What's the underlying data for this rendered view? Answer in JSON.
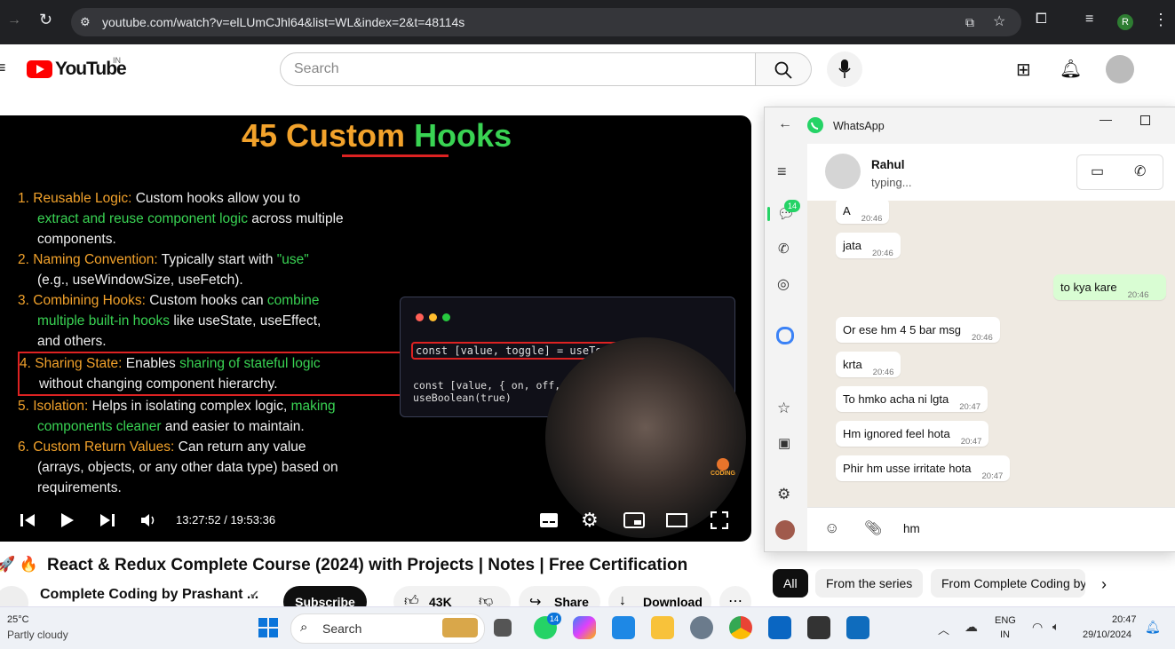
{
  "browser": {
    "url": "youtube.com/watch?v=elLUmCJhl64&list=WL&index=2&t=48114s",
    "profile_initial": "R"
  },
  "youtube": {
    "logo_text": "YouTube",
    "country": "IN",
    "search_placeholder": "Search",
    "video": {
      "slide_title_1": "45 Custom",
      "slide_title_2": "Hooks",
      "points": [
        {
          "num": "1.",
          "label": "Reusable Logic:",
          "text": " Custom hooks allow you to",
          "line2_green": "extract and reuse component logic",
          "line2": " across multiple",
          "line3": "components."
        },
        {
          "num": "2.",
          "label": "Naming Convention:",
          "text": " Typically start with ",
          "green": "\"use\"",
          "line2": "(e.g., useWindowSize, useFetch)."
        },
        {
          "num": "3.",
          "label": "Combining Hooks:",
          "text": " Custom hooks can ",
          "green": "combine",
          "line2_green": "multiple built-in hooks",
          "line2": " like useState, useEffect,",
          "line3": "and others."
        },
        {
          "num": "4.",
          "label": "Sharing State:",
          "text": " Enables ",
          "green": "sharing of stateful logic",
          "line2": "without changing component hierarchy."
        },
        {
          "num": "5.",
          "label": "Isolation:",
          "text": " Helps in isolating complex logic, ",
          "green": "making",
          "line2_green": "components cleaner",
          "line2": " and easier to maintain."
        },
        {
          "num": "6.",
          "label": "Custom Return Values:",
          "text": " Can return any value",
          "line2": "(arrays, objects, or any other data type) based on",
          "line3": "requirements."
        }
      ],
      "code_line1": "const [value, toggle] = useToggle(true)",
      "code_line2": "const [value, { on, off, toggle }] = useBoolean(true)",
      "watermark": "CODING",
      "time": "13:27:52 / 19:53:36",
      "progress_fraction": 0.685
    },
    "title_emoji": "🚀 🔥",
    "title": "React & Redux Complete Course (2024) with Projects | Notes | Free Certification",
    "channel": "Complete Coding by Prashant ...",
    "subscribe": "Subscribe",
    "likes": "43K",
    "share": "Share",
    "download": "Download",
    "chips": [
      "All",
      "From the series",
      "From Complete Coding by"
    ]
  },
  "whatsapp": {
    "app_title": "WhatsApp",
    "unread_badge": "14",
    "contact_name": "Rahul",
    "contact_status": "typing...",
    "composer_text": "hm",
    "messages": [
      {
        "dir": "in",
        "text": "A",
        "time": "20:46"
      },
      {
        "dir": "in",
        "text": "jata",
        "time": "20:46"
      },
      {
        "dir": "out",
        "text": "to kya kare",
        "time": "20:46"
      },
      {
        "dir": "in",
        "text": "Or ese hm 4 5 bar msg",
        "time": "20:46"
      },
      {
        "dir": "in",
        "text": "krta",
        "time": "20:46"
      },
      {
        "dir": "in",
        "text": "To hmko acha ni lgta",
        "time": "20:47"
      },
      {
        "dir": "in",
        "text": "Hm ignored feel hota",
        "time": "20:47"
      },
      {
        "dir": "in",
        "text": "Phir hm usse irritate hota",
        "time": "20:47"
      }
    ]
  },
  "taskbar": {
    "temp": "25°C",
    "weather": "Partly cloudy",
    "search": "Search",
    "whatsapp_badge": "14",
    "lang1": "ENG",
    "lang2": "IN",
    "time": "20:47",
    "date": "29/10/2024"
  },
  "colors": {
    "yt_red": "#ff0000",
    "wa_green": "#25d366",
    "chrome_bg": "#202124",
    "out_bubble": "#d9fdd3"
  }
}
